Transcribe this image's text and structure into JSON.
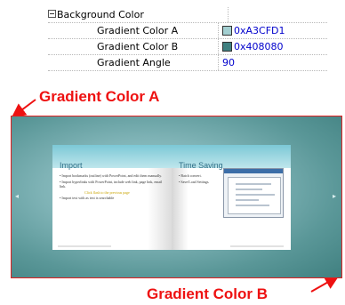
{
  "property_grid": {
    "section": {
      "label": "Background Color"
    },
    "rows": [
      {
        "name": "Gradient Color A",
        "value": "0xA3CFD1",
        "swatch": "#a3cfd1"
      },
      {
        "name": "Gradient Color B",
        "value": "0x408080",
        "swatch": "#408080"
      },
      {
        "name": "Gradient Angle",
        "value": "90"
      }
    ]
  },
  "annotations": {
    "top_label": "Gradient Color A",
    "bottom_label": "Gradient Color B",
    "color": "#ee1111"
  },
  "preview": {
    "left_page": {
      "title": "Import",
      "bullets": [
        "• Import bookmarks (outline) with PowerPoint, and edit them manually.",
        "• Import hyperlinks with PowerPoint, include web link, page link, email link.",
        "Click flash to the previous page",
        "• Import text with as text is searchable"
      ]
    },
    "right_page": {
      "title": "Time Saving",
      "bullets": [
        "• Batch convert.",
        "• Save/Load Settings."
      ]
    }
  }
}
